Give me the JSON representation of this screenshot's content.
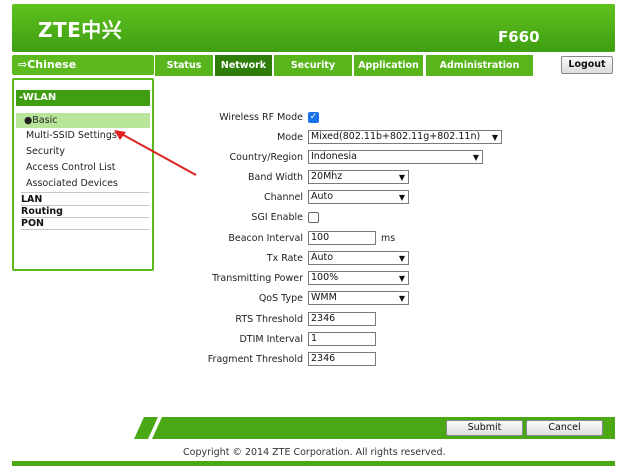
{
  "header": {
    "logo": "ZTE中兴",
    "model": "F660"
  },
  "language": {
    "label": "⇨Chinese"
  },
  "tabs": [
    "Status",
    "Network",
    "Security",
    "Application",
    "Administration"
  ],
  "active_tab": "Network",
  "logout_label": "Logout",
  "sidebar": {
    "section_title": "-WLAN",
    "sub_items": [
      "●Basic",
      "Multi-SSID Settings",
      "Security",
      "Access Control List",
      "Associated Devices"
    ],
    "sections": [
      "LAN",
      "Routing",
      "PON"
    ]
  },
  "form": {
    "wireless_rf_mode": {
      "label": "Wireless RF Mode",
      "checked": true
    },
    "mode": {
      "label": "Mode",
      "value": "Mixed(802.11b+802.11g+802.11n)"
    },
    "country": {
      "label": "Country/Region",
      "value": "Indonesia"
    },
    "band_width": {
      "label": "Band Width",
      "value": "20Mhz"
    },
    "channel": {
      "label": "Channel",
      "value": "Auto"
    },
    "sgi_enable": {
      "label": "SGI Enable",
      "checked": false
    },
    "beacon_interval": {
      "label": "Beacon Interval",
      "value": "100",
      "unit": "ms"
    },
    "tx_rate": {
      "label": "Tx Rate",
      "value": "Auto"
    },
    "transmitting_power": {
      "label": "Transmitting Power",
      "value": "100%"
    },
    "qos_type": {
      "label": "QoS Type",
      "value": "WMM"
    },
    "rts_threshold": {
      "label": "RTS Threshold",
      "value": "2346"
    },
    "dtim_interval": {
      "label": "DTIM Interval",
      "value": "1"
    },
    "fragment_threshold": {
      "label": "Fragment Threshold",
      "value": "2346"
    }
  },
  "buttons": {
    "submit": "Submit",
    "cancel": "Cancel"
  },
  "footer": {
    "copyright": "Copyright © 2014 ZTE Corporation. All rights reserved."
  },
  "colors": {
    "brand_green": "#4aa814",
    "active_tab": "#2d7d08",
    "annotation_arrow": "#e02020"
  }
}
